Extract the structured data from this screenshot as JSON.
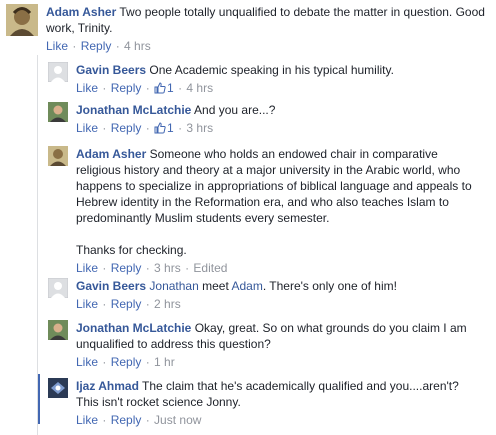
{
  "comments": [
    {
      "author": "Adam Asher",
      "text": "Two people totally unqualified to debate the matter in question. Good work, Trinity.",
      "like": "Like",
      "reply": "Reply",
      "time": "4 hrs"
    },
    {
      "author": "Gavin Beers",
      "text": "One Academic speaking in his typical humility.",
      "like": "Like",
      "reply": "Reply",
      "likes_count": "1",
      "time": "4 hrs"
    },
    {
      "author": "Jonathan McLatchie",
      "text": "And you are...?",
      "like": "Like",
      "reply": "Reply",
      "likes_count": "1",
      "time": "3 hrs"
    },
    {
      "author": "Adam Asher",
      "text": "Someone who holds an endowed chair in comparative religious history and theory at a major university in the Arabic world, who happens to specialize in appropriations of biblical language and appeals to Hebrew identity in the Reformation era, and who also teaches Islam to predominantly Muslim students every semester.",
      "text2": "Thanks for checking.",
      "like": "Like",
      "reply": "Reply",
      "time": "3 hrs",
      "edited": "Edited"
    },
    {
      "author": "Gavin Beers",
      "mention1": "Jonathan",
      "mid": " meet ",
      "mention2": "Adam",
      "tail": ". There's only one of him!",
      "like": "Like",
      "reply": "Reply",
      "time": "2 hrs"
    },
    {
      "author": "Jonathan McLatchie",
      "text": "Okay, great. So on what grounds do you claim I am unqualified to address this question?",
      "like": "Like",
      "reply": "Reply",
      "time": "1 hr"
    },
    {
      "author": "Ijaz Ahmad",
      "text": "The claim that he's academically qualified and you....aren't? This isn't rocket science Jonny.",
      "like": "Like",
      "reply": "Reply",
      "time": "Just now"
    }
  ],
  "colors": {
    "link": "#365899",
    "action": "#4267b2",
    "meta": "#90949c",
    "text": "#1d2129"
  }
}
